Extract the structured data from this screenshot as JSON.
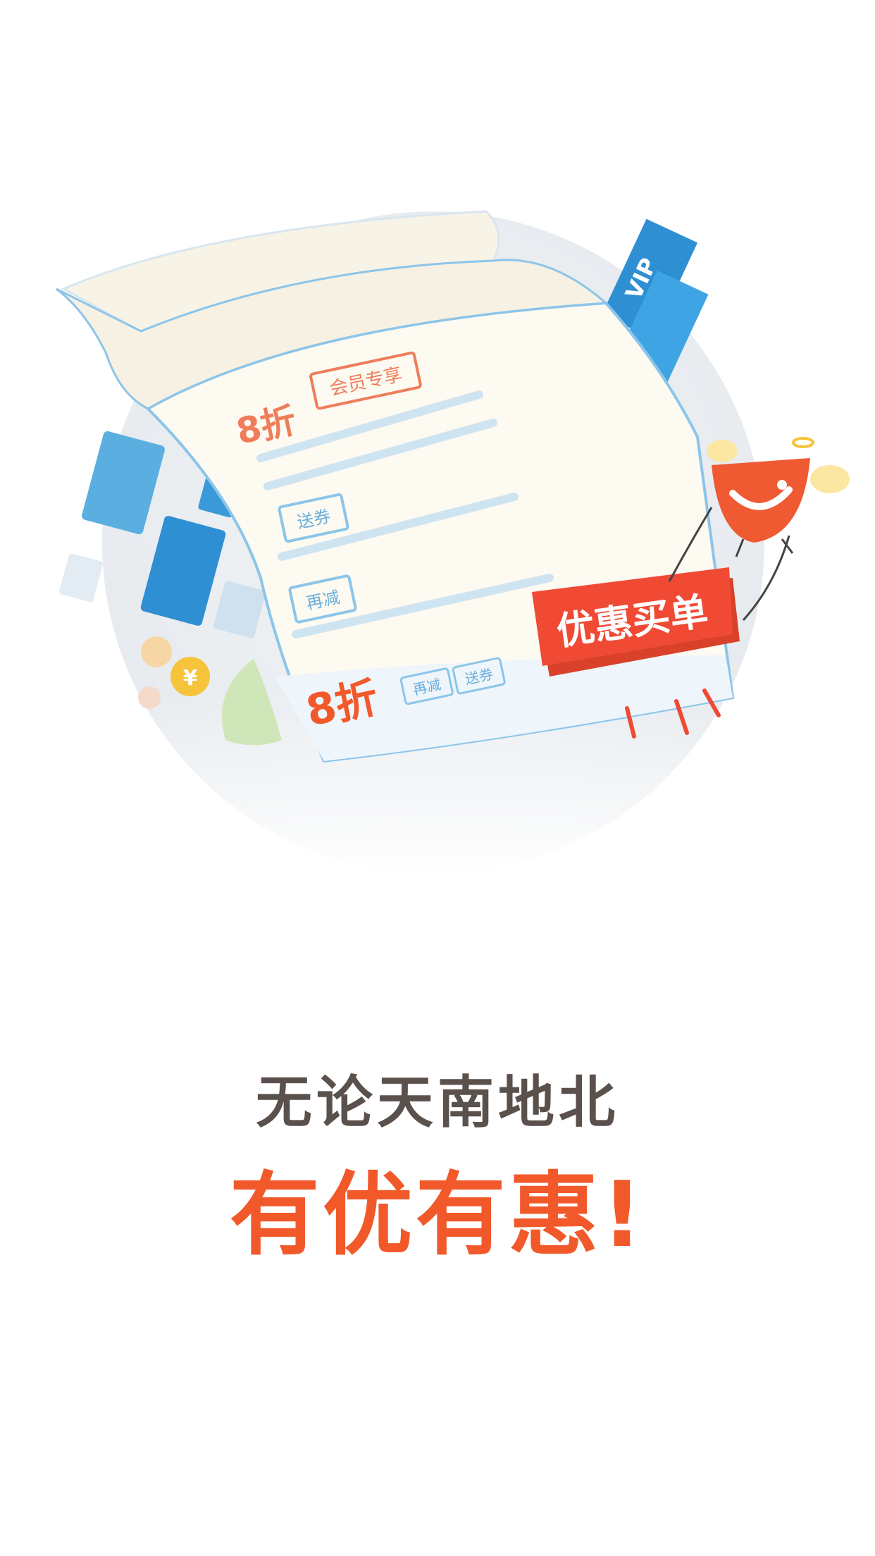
{
  "illustration": {
    "vip_tag": "VIP",
    "receipt": {
      "discount_top": "8折",
      "member_tag": "会员专享",
      "coupon_tag": "送券",
      "reduce_tag": "再减",
      "discount_bottom": "8折",
      "reduce_tag_small": "再减",
      "coupon_tag_small": "送券"
    },
    "stamp_label": "优惠买单",
    "coin_symbol": "¥"
  },
  "headline": {
    "line1": "无论天南地北",
    "line2": "有优有惠!"
  },
  "colors": {
    "accent": "#f2592a",
    "text_dark": "#5a514c",
    "blue": "#3a9ad9"
  }
}
